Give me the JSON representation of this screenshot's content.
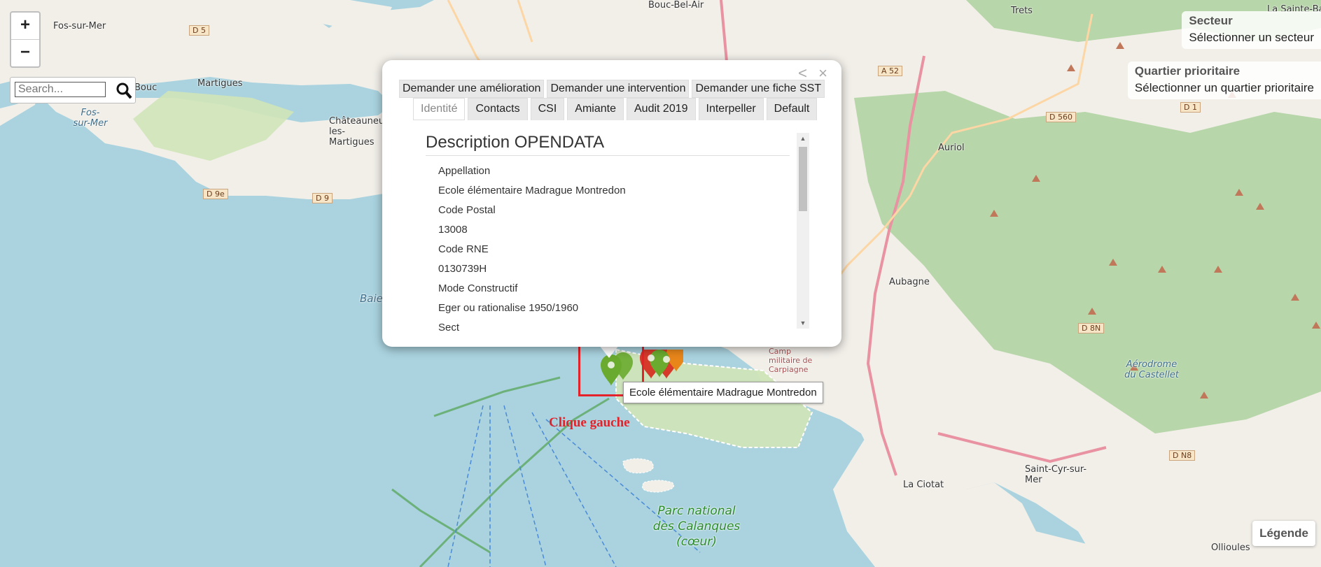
{
  "map": {
    "places": [
      {
        "name": "Bouc-Bel-Air"
      },
      {
        "name": "Trets"
      },
      {
        "name": "Fos-sur-Mer"
      },
      {
        "name": "Martigues"
      },
      {
        "name": "Châteauneuf-les-Martigues"
      },
      {
        "name": "Auriol"
      },
      {
        "name": "Aubagne"
      },
      {
        "name": "La Ciotat"
      },
      {
        "name": "Saint-Cyr-sur-Mer"
      },
      {
        "name": "Ollioules"
      },
      {
        "name": "Aérodrome du Castellet"
      },
      {
        "name": "Bouc"
      },
      {
        "name": "La Sainte-Baume"
      },
      {
        "name": "Fos-sur-Mer (sea)"
      }
    ],
    "roads": [
      "D 5",
      "D 9e",
      "D 9",
      "A 52",
      "D 560",
      "D 1",
      "D 8N",
      "D N8"
    ],
    "park_label": "Parc national des Calanques (cœur)",
    "camp_label": "Camp militaire de Carpiagne",
    "bay_label": "Baie"
  },
  "zoom": {
    "in_label": "+",
    "out_label": "−"
  },
  "search": {
    "placeholder": "Search..."
  },
  "secteur": {
    "title": "Secteur",
    "value": "Sélectionner un secteur"
  },
  "quartier": {
    "title": "Quartier prioritaire",
    "value": "Sélectionner un quartier prioritaire"
  },
  "legend": {
    "label": "Légende"
  },
  "popup": {
    "nav_prev": "<",
    "nav_close": "×",
    "actions": [
      "Demander une amélioration",
      "Demander une intervention",
      "Demander une fiche SST"
    ],
    "tabs": [
      "Identité",
      "Contacts",
      "CSI",
      "Amiante",
      "Audit 2019",
      "Interpeller",
      "Default"
    ],
    "active_tab": "Identité",
    "heading": "Description OPENDATA",
    "rows": [
      "Appellation",
      "Ecole élémentaire Madrague Montredon",
      "Code Postal",
      "13008",
      "Code RNE",
      "0130739H",
      "Mode Constructif",
      "Eger ou rationalise 1950/1960",
      "Sect"
    ]
  },
  "tooltip": {
    "text": "Ecole élémentaire Madrague Montredon"
  },
  "annotation": {
    "text": "Clique gauche"
  },
  "colors": {
    "sea": "#aad3df",
    "land": "#f2efe9",
    "forest": "#add19e",
    "highlight": "#e3222a",
    "pin_green": "#6aab2f",
    "pin_red": "#d63a2b",
    "pin_orange": "#e8861a"
  }
}
